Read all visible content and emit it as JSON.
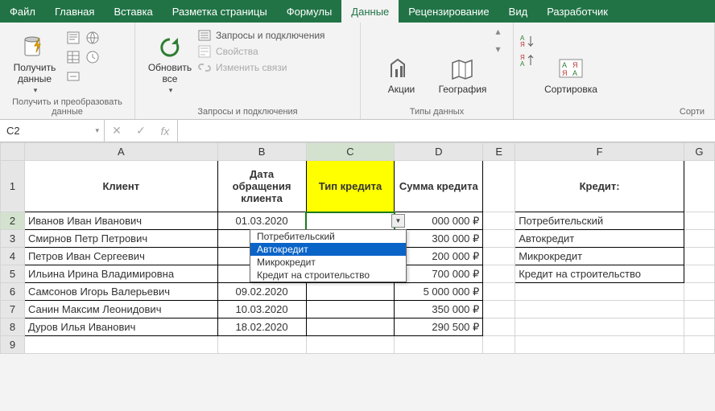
{
  "menu": {
    "tabs": [
      "Файл",
      "Главная",
      "Вставка",
      "Разметка страницы",
      "Формулы",
      "Данные",
      "Рецензирование",
      "Вид",
      "Разработчик"
    ],
    "active": 5
  },
  "ribbon": {
    "g1": {
      "label": "Получить и преобразовать данные",
      "btn": "Получить\nданные"
    },
    "g2": {
      "label": "Запросы и подключения",
      "btn": "Обновить\nвсе",
      "items": [
        "Запросы и подключения",
        "Свойства",
        "Изменить связи"
      ]
    },
    "g3": {
      "label": "Типы данных",
      "btn1": "Акции",
      "btn2": "География"
    },
    "g4": {
      "label": "Сорти",
      "btn": "Сортировка"
    }
  },
  "fbar": {
    "namebox": "C2",
    "fx": "fx",
    "value": ""
  },
  "cols": [
    "A",
    "B",
    "C",
    "D",
    "E",
    "F"
  ],
  "rowhead": [
    "1",
    "2",
    "3",
    "4",
    "5",
    "6",
    "7",
    "8",
    "9"
  ],
  "header": {
    "A": "Клиент",
    "B": "Дата обращения клиента",
    "C": "Тип кредита",
    "D": "Сумма кредита",
    "F": "Кредит:"
  },
  "rows": [
    {
      "A": "Иванов Иван Иванович",
      "B": "01.03.2020",
      "D": "000 000 ₽"
    },
    {
      "A": "Смирнов Петр Петрович",
      "B": "15.",
      "D": "300 000 ₽"
    },
    {
      "A": "Петров Иван Сергеевич",
      "B": "03.",
      "D": "200 000 ₽"
    },
    {
      "A": "Ильина Ирина Владимировна",
      "B": "17.",
      "D": "700 000 ₽"
    },
    {
      "A": "Самсонов Игорь Валерьевич",
      "B": "09.02.2020",
      "D": "5 000 000 ₽"
    },
    {
      "A": "Санин Максим Леонидович",
      "B": "10.03.2020",
      "D": "350 000 ₽"
    },
    {
      "A": "Дуров Илья Иванович",
      "B": "18.02.2020",
      "D": "290 500 ₽"
    }
  ],
  "sideList": [
    "Потребительский",
    "Автокредит",
    "Микрокредит",
    "Кредит на строительство"
  ],
  "dropdown": {
    "options": [
      "Потребительский",
      "Автокредит",
      "Микрокредит",
      "Кредит на строительство"
    ],
    "highlight": 1
  }
}
